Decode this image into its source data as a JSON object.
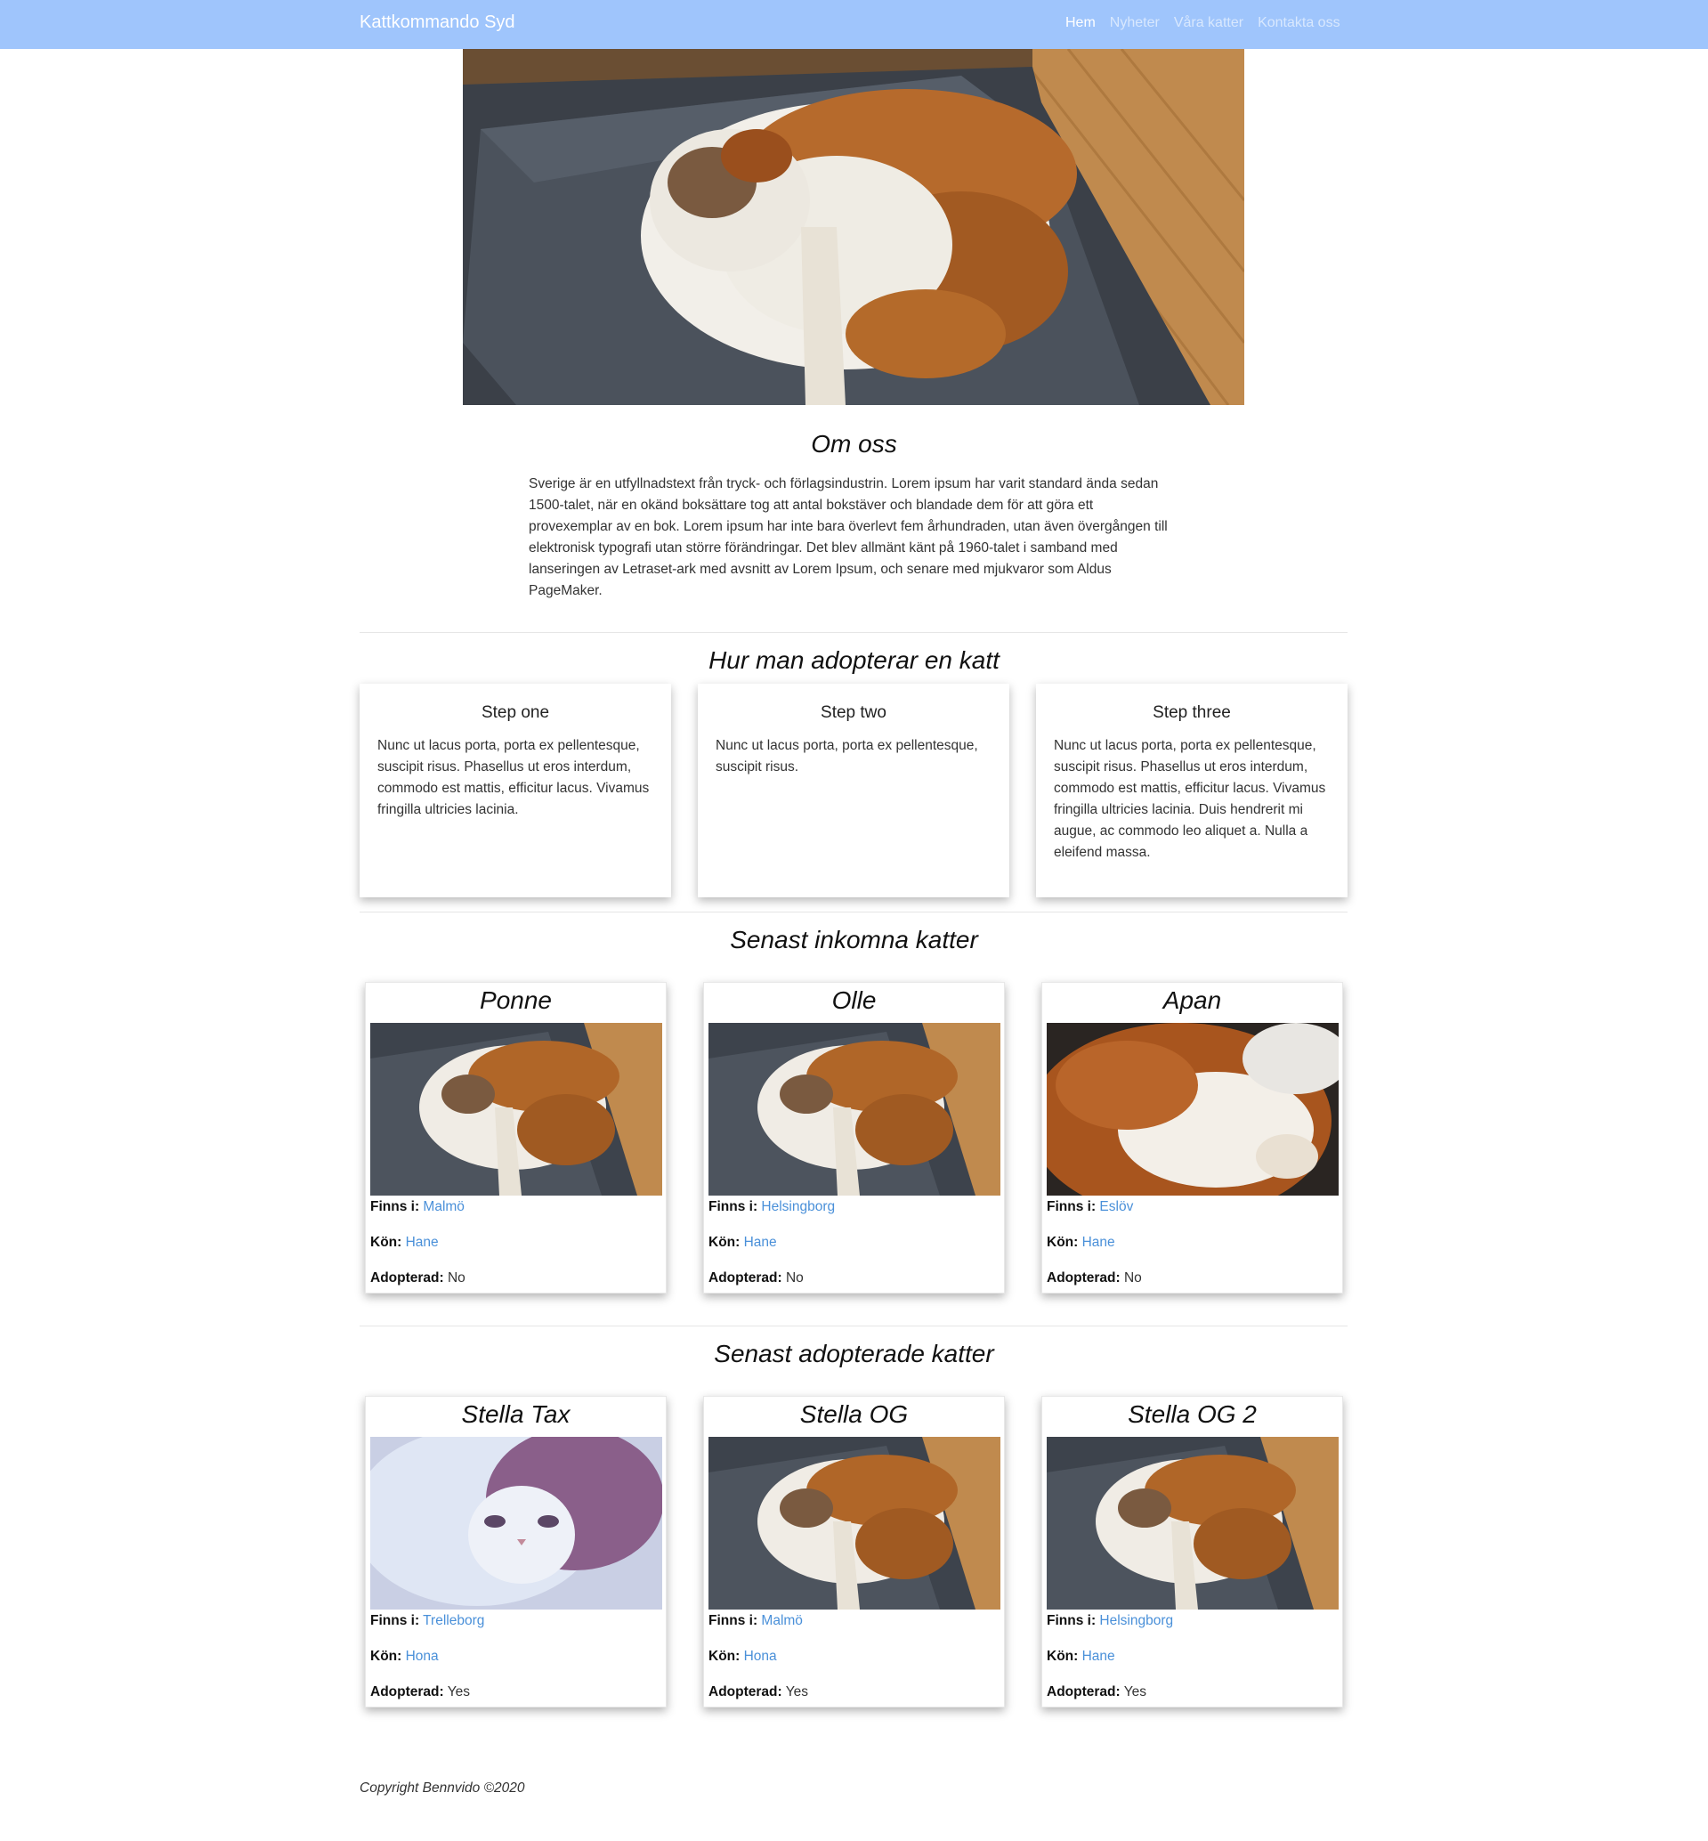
{
  "navbar": {
    "brand": "Kattkommando Syd",
    "links": [
      {
        "label": "Hem"
      },
      {
        "label": "Nyheter"
      },
      {
        "label": "Våra katter"
      },
      {
        "label": "Kontakta oss"
      }
    ]
  },
  "about": {
    "title": "Om oss",
    "text": "Sverige är en utfyllnadstext från tryck- och förlagsindustrin. Lorem ipsum har varit standard ända sedan 1500-talet, när en okänd boksättare tog att antal bokstäver och blandade dem för att göra ett provexemplar av en bok. Lorem ipsum har inte bara överlevt fem århundraden, utan även övergången till elektronisk typografi utan större förändringar. Det blev allmänt känt på 1960-talet i samband med lanseringen av Letraset-ark med avsnitt av Lorem Ipsum, och senare med mjukvaror som Aldus PageMaker."
  },
  "adopt": {
    "title": "Hur man adopterar en katt",
    "steps": [
      {
        "title": "Step one",
        "text": "Nunc ut lacus porta, porta ex pellentesque, suscipit risus. Phasellus ut eros interdum, commodo est mattis, efficitur lacus. Vivamus fringilla ultricies lacinia."
      },
      {
        "title": "Step two",
        "text": "Nunc ut lacus porta, porta ex pellentesque, suscipit risus."
      },
      {
        "title": "Step three",
        "text": "Nunc ut lacus porta, porta ex pellentesque, suscipit risus. Phasellus ut eros interdum, commodo est mattis, efficitur lacus. Vivamus fringilla ultricies lacinia. Duis hendrerit mi augue, ac commodo leo aliquet a. Nulla a eleifend massa."
      }
    ]
  },
  "labels": {
    "location": "Finns i:",
    "gender": "Kön:",
    "adopted": "Adopterad:"
  },
  "recent": {
    "title": "Senast inkomna katter",
    "cats": [
      {
        "name": "Ponne",
        "location": "Malmö",
        "gender": "Hane",
        "adopted": "No"
      },
      {
        "name": "Olle",
        "location": "Helsingborg",
        "gender": "Hane",
        "adopted": "No"
      },
      {
        "name": "Apan",
        "location": "Eslöv",
        "gender": "Hane",
        "adopted": "No"
      }
    ]
  },
  "adopted": {
    "title": "Senast adopterade katter",
    "cats": [
      {
        "name": "Stella Tax",
        "location": "Trelleborg",
        "gender": "Hona",
        "adopted": "Yes"
      },
      {
        "name": "Stella OG",
        "location": "Malmö",
        "gender": "Hona",
        "adopted": "Yes"
      },
      {
        "name": "Stella OG 2",
        "location": "Helsingborg",
        "gender": "Hane",
        "adopted": "Yes"
      }
    ]
  },
  "footer": {
    "text": "Copyright Bennvido ©2020"
  },
  "colors": {
    "navbar": "#9fc5fc",
    "link": "#4a90d9"
  },
  "images": {
    "hero": "cat-sleeping-on-cushion",
    "cards": [
      "cat-sleeping-on-cushion",
      "cat-sleeping-on-cushion",
      "cat-closeup-fur",
      "cat-face-tinted",
      "cat-sleeping-on-cushion",
      "cat-sleeping-on-cushion"
    ]
  }
}
